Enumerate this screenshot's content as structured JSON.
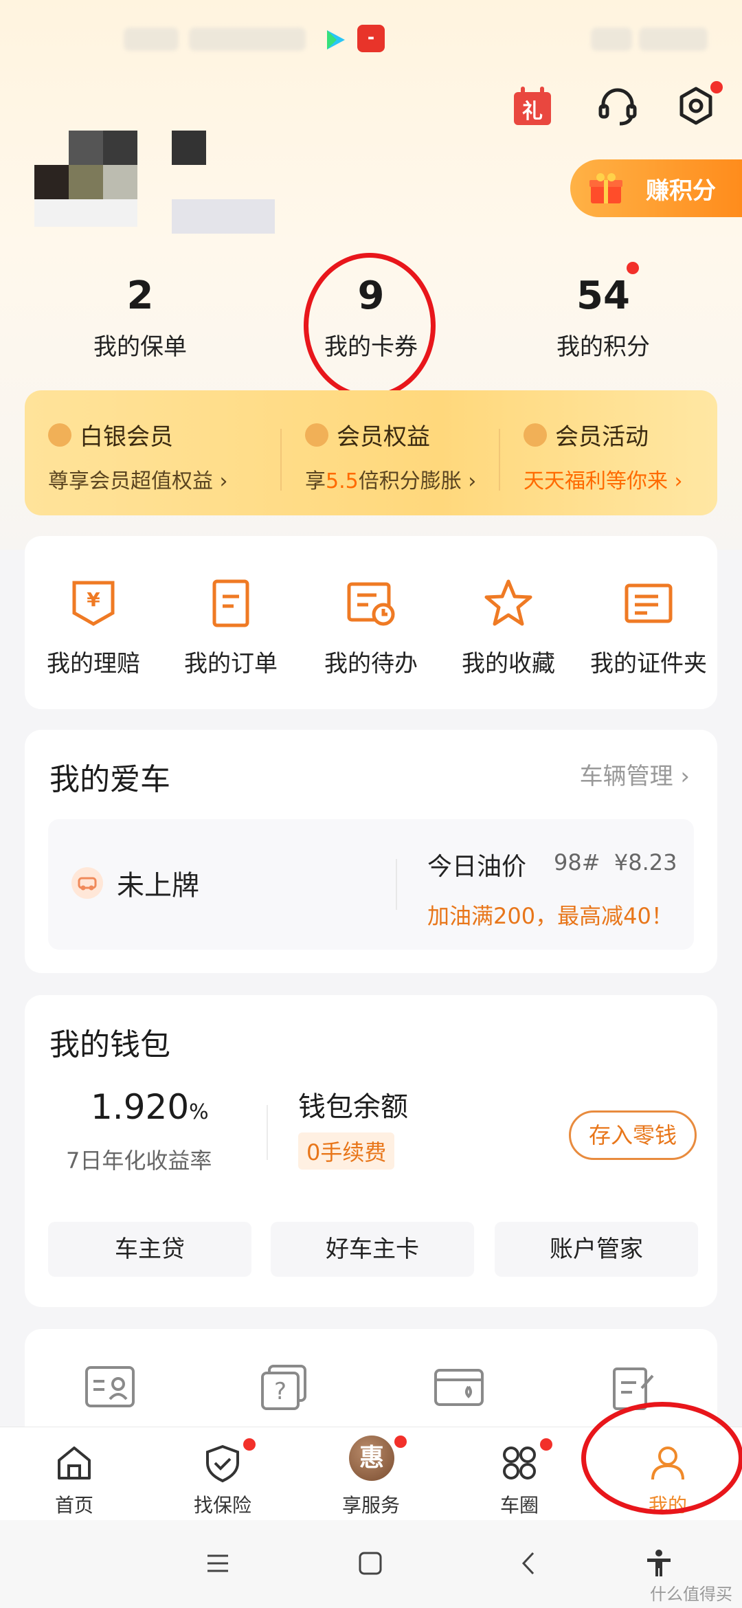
{
  "top_actions": {
    "gift": "礼",
    "earn_points": "赚积分"
  },
  "stats": [
    {
      "value": "2",
      "label": "我的保单"
    },
    {
      "value": "9",
      "label": "我的卡券"
    },
    {
      "value": "54",
      "label": "我的积分"
    }
  ],
  "membership": {
    "level": {
      "title": "白银会员",
      "subtitle": "尊享会员超值权益"
    },
    "benefits": {
      "title": "会员权益",
      "subtitle_prefix": "享",
      "subtitle_highlight": "5.5",
      "subtitle_suffix": "倍积分膨胀"
    },
    "activity": {
      "title": "会员活动",
      "subtitle": "天天福利等你来"
    }
  },
  "quick_entries": [
    "我的理赔",
    "我的订单",
    "我的待办",
    "我的收藏",
    "我的证件夹"
  ],
  "car": {
    "title": "我的爱车",
    "manage_link": "车辆管理",
    "plate": "未上牌",
    "oil_label": "今日油价",
    "oil_grade": "98#",
    "oil_price": "¥8.23",
    "oil_promo": "加油满200，最高减40！"
  },
  "wallet": {
    "title": "我的钱包",
    "rate_value": "1.920",
    "rate_unit": "%",
    "rate_label": "7日年化收益率",
    "balance_label": "钱包余额",
    "fee_badge": "0手续费",
    "deposit_button": "存入零钱",
    "buttons": [
      "车主贷",
      "好车主卡",
      "账户管家"
    ]
  },
  "tabbar": [
    {
      "label": "首页",
      "icon": "home-icon",
      "badge": false
    },
    {
      "label": "找保险",
      "icon": "shield-check-icon",
      "badge": true
    },
    {
      "label": "享服务",
      "icon": "hui-icon",
      "badge": true,
      "glyph": "惠"
    },
    {
      "label": "车圈",
      "icon": "grid-circles-icon",
      "badge": true
    },
    {
      "label": "我的",
      "icon": "person-icon",
      "badge": false,
      "active": true
    }
  ],
  "watermark": "什么值得买",
  "colors": {
    "accent": "#f08a2a",
    "badge": "#f2302a",
    "annotation": "#e8161b"
  }
}
